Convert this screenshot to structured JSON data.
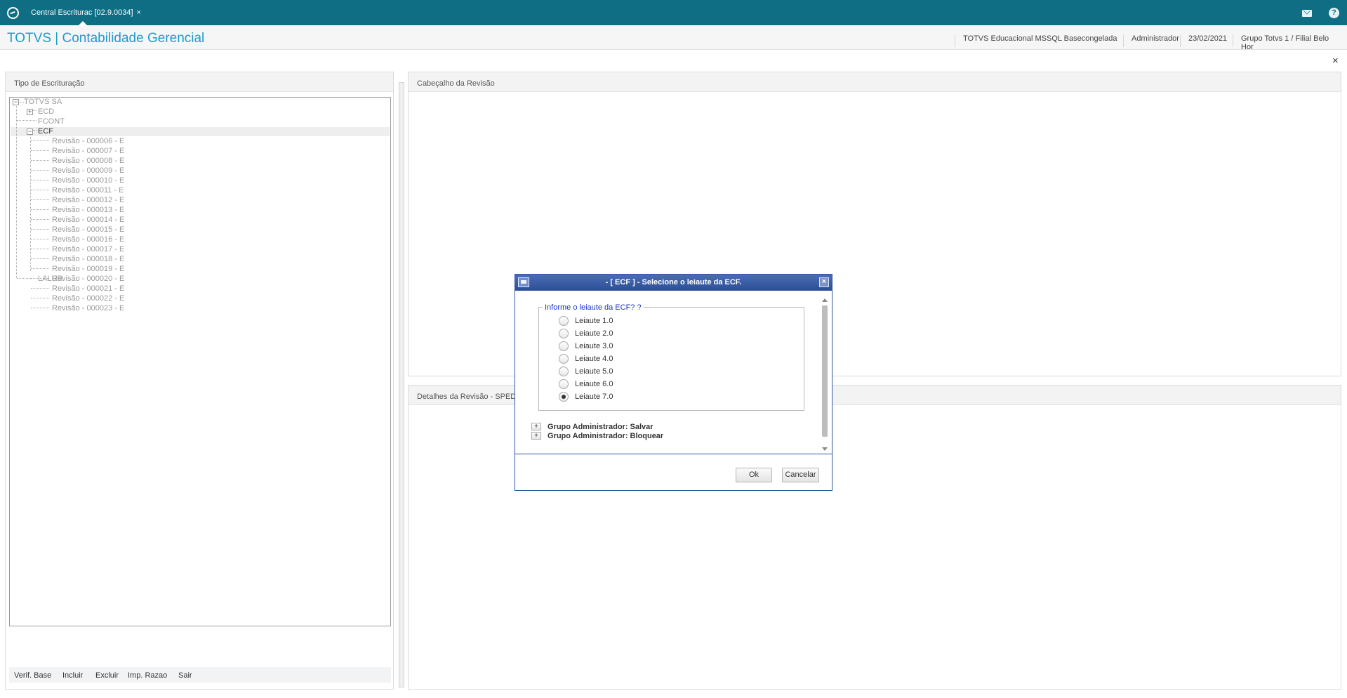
{
  "tab": {
    "title": "Central Escriturac [02.9.0034]",
    "close": "×"
  },
  "header": {
    "app_title": "TOTVS | Contabilidade Gerencial",
    "environment": "TOTVS Educacional MSSQL Basecongelada",
    "user": "Administrador",
    "date": "23/02/2021",
    "branch": "Grupo Totvs 1 / Filial Belo Hor"
  },
  "close_label": "×",
  "left_panel": {
    "title": "Tipo de Escrituração",
    "tree": {
      "root": "TOTVS SA",
      "nodes": [
        "ECD",
        "FCONT",
        "ECF"
      ],
      "revisions": [
        "Revisão - 000006 - E",
        "Revisão - 000007 - E",
        "Revisão - 000008 - E",
        "Revisão - 000009 - E",
        "Revisão - 000010 - E",
        "Revisão - 000011 - E",
        "Revisão - 000012 - E",
        "Revisão - 000013 - E",
        "Revisão - 000014 - E",
        "Revisão - 000015 - E",
        "Revisão - 000016 - E",
        "Revisão - 000017 - E",
        "Revisão - 000018 - E",
        "Revisão - 000019 - E",
        "Revisão - 000020 - E",
        "Revisão - 000021 - E",
        "Revisão - 000022 - E",
        "Revisão - 000023 - E"
      ],
      "last": "LALUR"
    },
    "buttons": [
      "Verif. Base",
      "Incluir",
      "Excluir",
      "Imp. Razao",
      "Sair"
    ]
  },
  "right_top": {
    "title": "Cabeçalho da Revisão"
  },
  "right_bottom": {
    "title": "Detalhes da Revisão - SPED"
  },
  "dialog": {
    "title": "-  [ ECF ] - Selecione o leiaute da ECF.",
    "close": "×",
    "legend": "Informe o leiaute da ECF? ?",
    "options": [
      "Leiaute 1.0",
      "Leiaute 2.0",
      "Leiaute 3.0",
      "Leiaute 4.0",
      "Leiaute 5.0",
      "Leiaute 6.0",
      "Leiaute 7.0"
    ],
    "selected_option": "Leiaute 7.0",
    "groups": [
      "Grupo Administrador: Salvar",
      "Grupo Administrador: Bloquear"
    ],
    "ok": "Ok",
    "cancel": "Cancelar"
  },
  "colors": {
    "topbar": "#0f6e84",
    "title": "#1f9bc7",
    "dialog_border": "#2f57a0",
    "legend": "#1a2fd0"
  },
  "icons": {
    "logo": "totvs-logo-icon",
    "mail": "mail-icon",
    "help": "help-icon",
    "dialog": "window-icon"
  }
}
